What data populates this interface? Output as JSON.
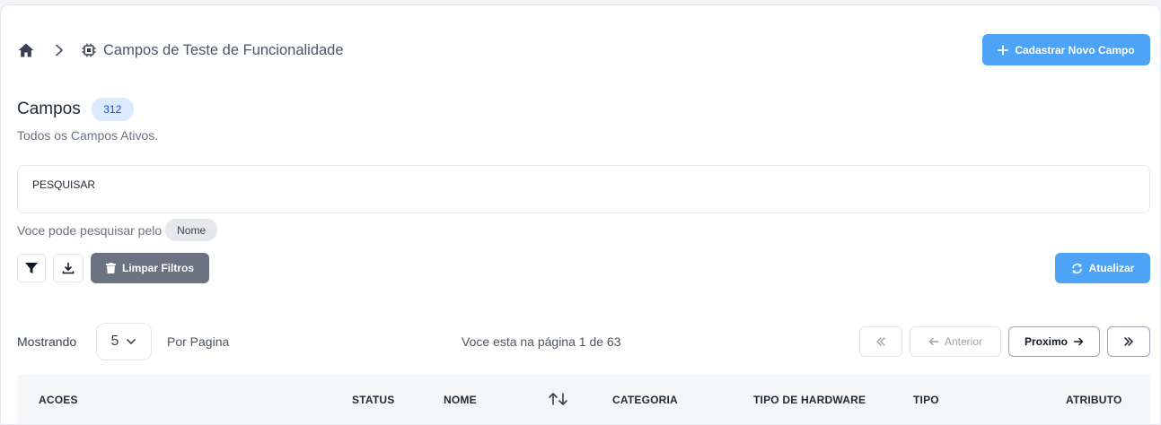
{
  "breadcrumb": {
    "home_icon": "home-icon",
    "separator_icon": "chevron-right-icon",
    "section_icon": "chip-icon",
    "title": "Campos de Teste de Funcionalidade"
  },
  "actions": {
    "new_label": "Cadastrar Novo Campo",
    "refresh_label": "Atualizar",
    "clear_label": "Limpar Filtros"
  },
  "header": {
    "title": "Campos",
    "count": "312",
    "subtitle": "Todos os Campos Ativos."
  },
  "search": {
    "placeholder": "PESQUISAR",
    "hint": "Voce pode pesquisar pelo",
    "fields": [
      "Nome"
    ]
  },
  "pagination": {
    "showing_label": "Mostrando",
    "per_page_value": "5",
    "per_page_label": "Por Pagina",
    "page_info": "Voce esta na página 1 de 63",
    "prev_label": "Anterior",
    "next_label": "Proximo"
  },
  "table": {
    "columns": [
      "ACOES",
      "STATUS",
      "NOME",
      "CATEGORIA",
      "TIPO DE HARDWARE",
      "TIPO",
      "ATRIBUTO"
    ]
  },
  "colors": {
    "primary": "#4da3f5",
    "secondary": "#6b7280",
    "badge_bg": "#dbeafe",
    "badge_text": "#1d4ed8"
  }
}
